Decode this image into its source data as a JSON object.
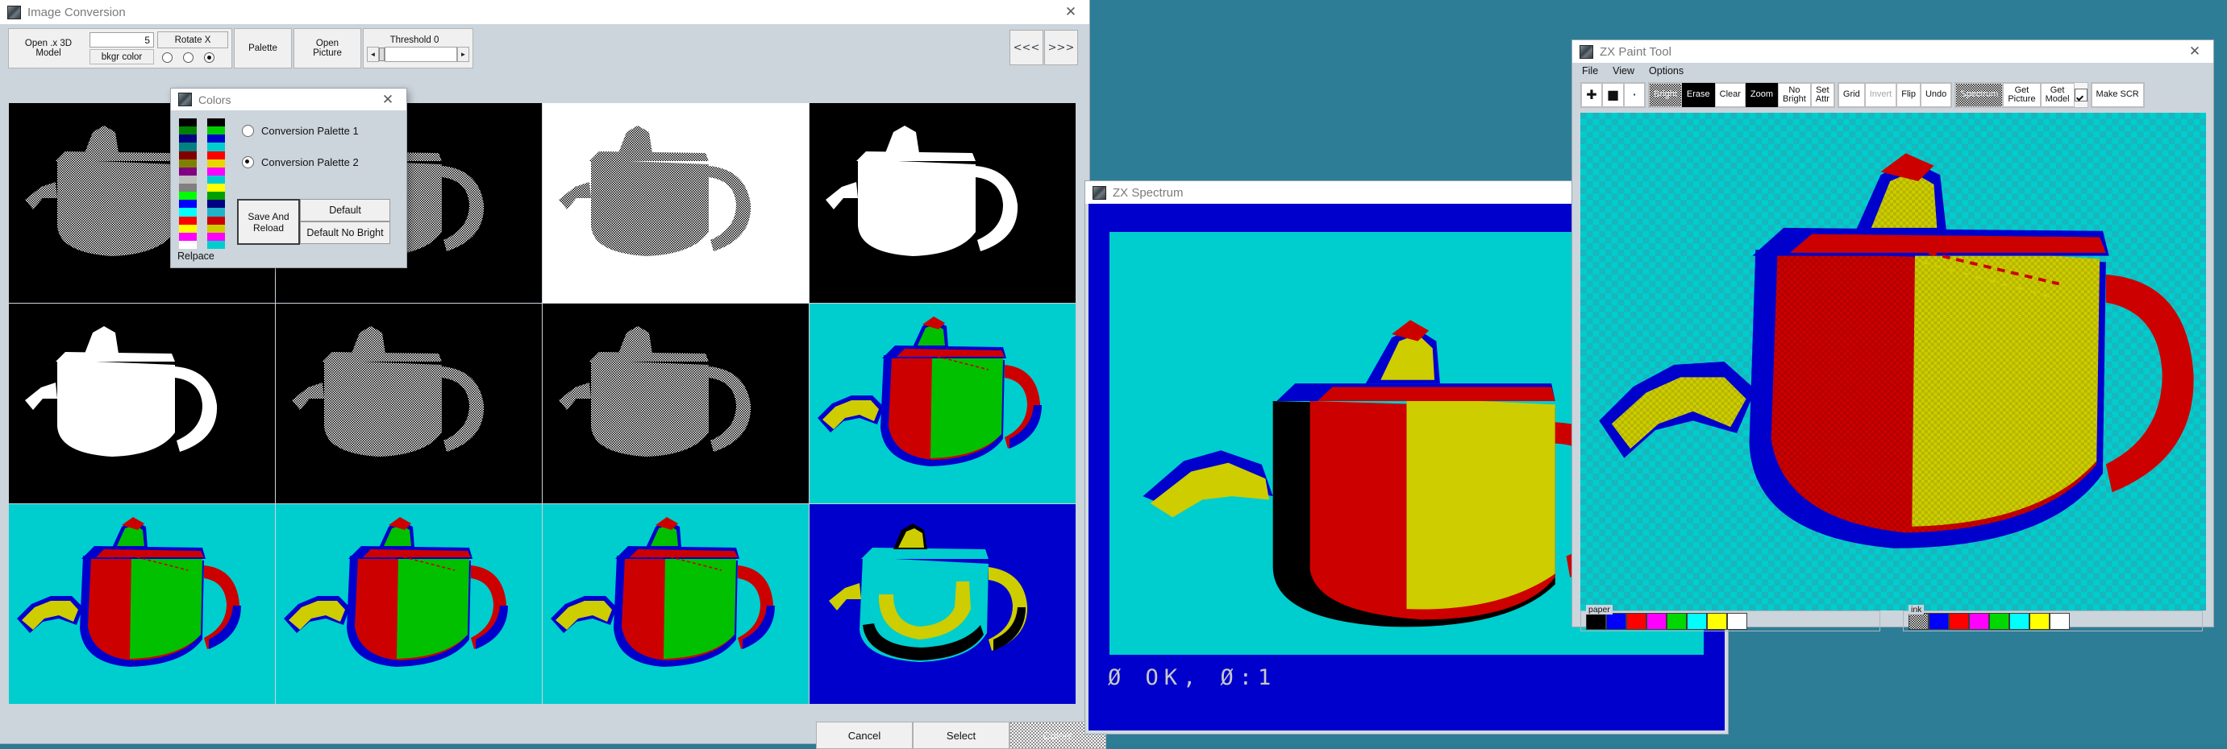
{
  "desktop": {
    "bg": "#2e7d96"
  },
  "image_conversion": {
    "title": "Image Conversion",
    "icon": "app-icon",
    "close": "✕",
    "toolbar": {
      "open_model_line1": "Open .x 3D",
      "open_model_line2": "Model",
      "rotate_value": "5",
      "rotate_button": "Rotate X",
      "bkgr_label": "bkgr color",
      "bkgr_options": [
        "option-1",
        "option-2",
        "option-3"
      ],
      "bkgr_selected_index": 2,
      "palette": "Palette",
      "open_picture_line1": "Open",
      "open_picture_line2": "Picture",
      "threshold_label": "Threshold 0",
      "threshold_left_arrow": "◄",
      "threshold_right_arrow": "►"
    },
    "nav": {
      "prev": "<<<",
      "next": ">>>"
    },
    "bottom_buttons": [
      {
        "label": "Cancel",
        "style": "normal"
      },
      {
        "label": "Select",
        "style": "normal"
      },
      {
        "label": "Colors",
        "style": "dithered"
      }
    ],
    "thumbnails": [
      {
        "index": 0,
        "bg": "#000000",
        "render": "dither-white",
        "body": "#ffffff"
      },
      {
        "index": 1,
        "bg": "#000000",
        "render": "dither-white",
        "body": "#ffffff"
      },
      {
        "index": 2,
        "bg": "#ffffff",
        "render": "dither-black",
        "body": "#000000"
      },
      {
        "index": 3,
        "bg": "#000000",
        "render": "solid-white",
        "body": "#ffffff"
      },
      {
        "index": 4,
        "bg": "#000000",
        "render": "solid-white",
        "body": "#ffffff"
      },
      {
        "index": 5,
        "bg": "#000000",
        "render": "dither-white",
        "body": "#ffffff"
      },
      {
        "index": 6,
        "bg": "#000000",
        "render": "dither-white",
        "body": "#ffffff"
      },
      {
        "index": 7,
        "bg": "#00cdcd",
        "render": "color-spectrum",
        "body": "#cd0000"
      },
      {
        "index": 8,
        "bg": "#00cdcd",
        "render": "color-spectrum",
        "body": "#cd0000"
      },
      {
        "index": 9,
        "bg": "#00cdcd",
        "render": "color-spectrum",
        "body": "#cd0000"
      },
      {
        "index": 10,
        "bg": "#00cdcd",
        "render": "color-spectrum",
        "body": "#cd0000"
      },
      {
        "index": 11,
        "bg": "#0000cd",
        "render": "color-yellow",
        "body": "#cdcd00"
      }
    ]
  },
  "colors_dialog": {
    "title": "Colors",
    "close": "✕",
    "replace_label": "Relpace",
    "palette_left": [
      "#000000",
      "#008000",
      "#000080",
      "#008080",
      "#800000",
      "#808000",
      "#800080",
      "#c0c0c0",
      "#808080",
      "#00ff00",
      "#0000ff",
      "#00ffff",
      "#ff0000",
      "#ffff00",
      "#ff00ff",
      "#ffffff"
    ],
    "palette_right": [
      "#000000",
      "#00cd00",
      "#0000cd",
      "#00cdcd",
      "#ff0000",
      "#e6d700",
      "#ff00ff",
      "#00cdcd",
      "#ffff00",
      "#00a000",
      "#000080",
      "#20b2c8",
      "#cd0000",
      "#cdcd00",
      "#ff00ff",
      "#00cdcd"
    ],
    "radios": [
      {
        "label": "Conversion Palette 1",
        "selected": false
      },
      {
        "label": "Conversion Palette 2",
        "selected": true
      }
    ],
    "save_button_line1": "Save And",
    "save_button_line2": "Reload",
    "default_button": "Default",
    "default_no_bright_button": "Default No Bright"
  },
  "zx_spectrum": {
    "title": "ZX Spectrum",
    "border_color": "#0000cd",
    "paper_color": "#00cdcd",
    "status_text": "Ø OK, Ø:1"
  },
  "zx_paint": {
    "title": "ZX Paint Tool",
    "close": "✕",
    "menu": [
      "File",
      "View",
      "Options"
    ],
    "toolbar_groups": [
      {
        "buttons": [
          {
            "label": "✚",
            "style": "glyph"
          },
          {
            "label": "■",
            "style": "glyph"
          },
          {
            "label": "·",
            "style": "glyph"
          }
        ]
      },
      {
        "buttons": [
          {
            "label": "Bright",
            "style": "dithered"
          },
          {
            "label": "Erase",
            "style": "inverted"
          },
          {
            "label": "Clear",
            "style": "normal"
          },
          {
            "label": "Zoom",
            "style": "inverted"
          },
          {
            "label": "No Bright",
            "style": "normal"
          },
          {
            "label": "Set Attr",
            "style": "normal"
          }
        ]
      },
      {
        "buttons": [
          {
            "label": "Grid",
            "style": "normal"
          },
          {
            "label": "Invert",
            "style": "disabled"
          },
          {
            "label": "Flip",
            "style": "normal"
          },
          {
            "label": "Undo",
            "style": "normal"
          }
        ]
      },
      {
        "buttons": [
          {
            "label": "Spectrum",
            "style": "dithered"
          },
          {
            "label": "Get Picture",
            "style": "normal"
          },
          {
            "label": "Get Model",
            "style": "normal"
          },
          {
            "label": "checkbox",
            "style": "checkbox"
          }
        ]
      },
      {
        "buttons": [
          {
            "label": "Make SCR",
            "style": "normal"
          }
        ]
      }
    ],
    "paper": {
      "label": "paper",
      "swatches": [
        "#000000",
        "#0000ff",
        "#ff0000",
        "#ff00ff",
        "#00d800",
        "#00ffff",
        "#ffff00",
        "#ffffff"
      ]
    },
    "ink": {
      "label": "ink",
      "swatches": [
        "dither",
        "#0000ff",
        "#ff0000",
        "#ff00ff",
        "#00d800",
        "#00ffff",
        "#ffff00",
        "#ffffff"
      ]
    },
    "canvas_bg": "#00cdcd"
  }
}
